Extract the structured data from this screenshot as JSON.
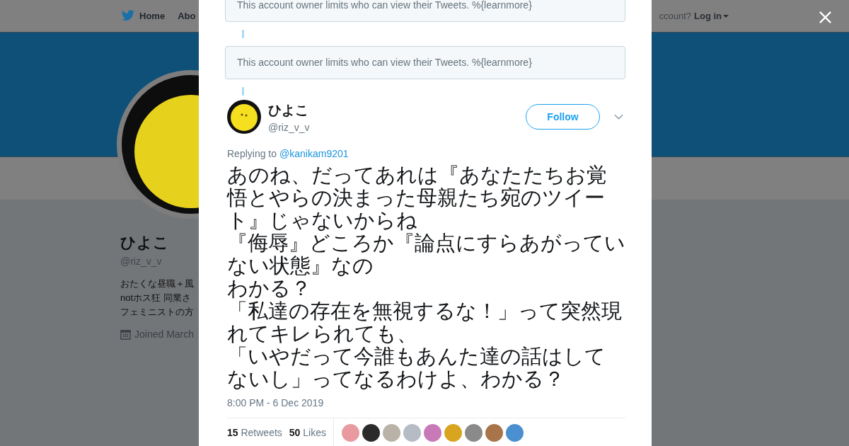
{
  "background": {
    "nav": [
      {
        "label": "Home",
        "kind": "home"
      },
      {
        "label": "Abo",
        "kind": "plain"
      }
    ],
    "account_prompt": "ccount?",
    "login": "Log in",
    "profile": {
      "name": "ひよこ",
      "handle": "@riz_v_v",
      "bio": [
        "おたくな昼職＋風",
        "notホス狂 同業さ",
        "フェミニストの方"
      ],
      "joined": "Joined March"
    }
  },
  "modal": {
    "notices": [
      "This account owner limits who can view their Tweets. %{learnmore}",
      "This account owner limits who can view their Tweets. %{learnmore}"
    ],
    "tweet": {
      "name": "ひよこ",
      "handle": "@riz_v_v",
      "follow": "Follow",
      "replying_label": "Replying to",
      "replying_to": "@kanikam9201",
      "text": [
        "あのね、だってあれは『あなたたちお覚悟とやらの決まった母親たち宛のツイート』じゃないからね",
        "『侮辱』どころか『論点にすらあがっていない状態』なの",
        "わかる？",
        "「私達の存在を無視するな！」って突然現れてキレられても、",
        "「いやだって今誰もあんた達の話はしてないし」ってなるわけよ、わかる？"
      ],
      "time": "8:00 PM - 6 Dec 2019",
      "retweets": "15",
      "retweets_label": "Retweets",
      "likes": "50",
      "likes_label": "Likes",
      "likers": [
        {
          "color": "#e89aa0"
        },
        {
          "color": "#2b2b2b"
        },
        {
          "color": "#b9b2a6"
        },
        {
          "color": "#b5bcc4"
        },
        {
          "color": "#c87ab8"
        },
        {
          "color": "#d9a520"
        },
        {
          "color": "#8a8a8a"
        },
        {
          "color": "#a8744a"
        },
        {
          "color": "#4a8fd0"
        }
      ]
    }
  }
}
